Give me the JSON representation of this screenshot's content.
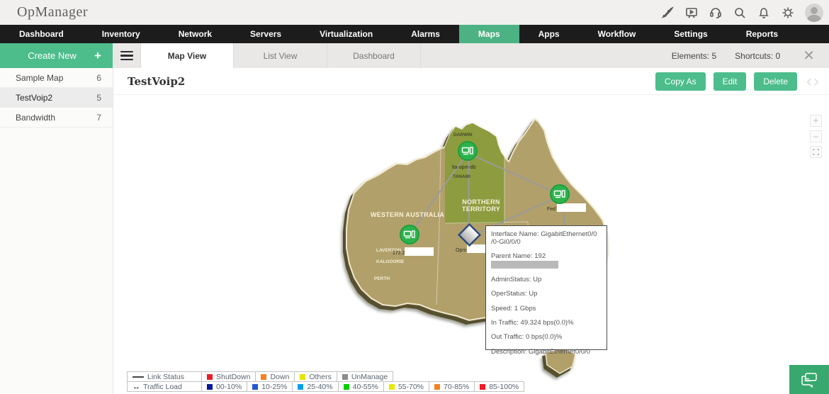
{
  "app": {
    "title": "OpManager"
  },
  "header_icons": [
    "rocket-icon",
    "presentation-icon",
    "headset-icon",
    "search-icon",
    "bell-icon",
    "gear-icon",
    "avatar"
  ],
  "nav": {
    "items": [
      {
        "label": "Dashboard",
        "active": false
      },
      {
        "label": "Inventory",
        "active": false
      },
      {
        "label": "Network",
        "active": false
      },
      {
        "label": "Servers",
        "active": false
      },
      {
        "label": "Virtualization",
        "active": false
      },
      {
        "label": "Alarms",
        "active": false
      },
      {
        "label": "Maps",
        "active": true
      },
      {
        "label": "Apps",
        "active": false
      },
      {
        "label": "Workflow",
        "active": false
      },
      {
        "label": "Settings",
        "active": false
      },
      {
        "label": "Reports",
        "active": false
      }
    ]
  },
  "sidebar": {
    "create_button": {
      "label": "Create New",
      "icon": "+"
    },
    "items": [
      {
        "label": "Sample Map",
        "count": "6",
        "selected": false
      },
      {
        "label": "TestVoip2",
        "count": "5",
        "selected": true
      },
      {
        "label": "Bandwidth",
        "count": "7",
        "selected": false
      }
    ]
  },
  "tabbar": {
    "tabs": [
      {
        "label": "Map View",
        "active": true
      },
      {
        "label": "List View",
        "active": false
      },
      {
        "label": "Dashboard",
        "active": false
      }
    ],
    "elements_label": "Elements:",
    "elements_value": "5",
    "shortcuts_label": "Shortcuts:",
    "shortcuts_value": "0"
  },
  "toolbar": {
    "title": "TestVoip2",
    "buttons": [
      "Copy As",
      "Edit",
      "Delete"
    ]
  },
  "map": {
    "controls": {
      "zoom_in": "+",
      "zoom_out": "–"
    },
    "labels": {
      "darwin": "DARWIN",
      "tanami": "TANAMI",
      "nt_line1": "NORTHERN",
      "nt_line2": "TERRITORY",
      "wa": "WESTERN AUSTRALIA",
      "laverton": "LAVERTON",
      "kalgoorlie": "KALGOORIE",
      "perth": "PERTH"
    },
    "nodes": {
      "darwin_device": {
        "label": "lta-opm-db"
      },
      "wa_device": {
        "label": "172.2"
      },
      "east_device": {
        "label": "Fed"
      },
      "selected_interface": {
        "label": "Opm"
      }
    },
    "colors": {
      "land": "#b2a06b",
      "territory": "#8d9c3f",
      "node_green": "#2db34d",
      "link_gray": "#9a9a9a"
    }
  },
  "tooltip": {
    "lines": [
      {
        "label": "Interface Name:",
        "value": "GigabitEthernet0/0 /0-Gi0/0/0"
      },
      {
        "label": "Parent Name:",
        "value": "192"
      },
      {
        "label": "AdminStatus:",
        "value": "Up"
      },
      {
        "label": "OperStatus:",
        "value": "Up"
      },
      {
        "label": "Speed:",
        "value": "1 Gbps"
      },
      {
        "label": "In Traffic:",
        "value": "49.324 bps(0.0)%"
      },
      {
        "label": "Out Traffic:",
        "value": "0 bps(0.0)%"
      },
      {
        "label": "Description:",
        "value": "GigabitEthernet0/0/0"
      }
    ]
  },
  "legend": {
    "rows": [
      {
        "title": "Link Status",
        "items": [
          {
            "label": "ShutDown",
            "color": "#ee1c25"
          },
          {
            "label": "Down",
            "color": "#f6821f"
          },
          {
            "label": "Others",
            "color": "#e8e400"
          },
          {
            "label": "UnManage",
            "color": "#8c8c8c"
          }
        ]
      },
      {
        "title": "Traffic Load",
        "items": [
          {
            "label": "00-10%",
            "color": "#001a99"
          },
          {
            "label": "10-25%",
            "color": "#2457d6"
          },
          {
            "label": "25-40%",
            "color": "#00a0f0"
          },
          {
            "label": "40-55%",
            "color": "#00d000"
          },
          {
            "label": "55-70%",
            "color": "#e8e800"
          },
          {
            "label": "70-85%",
            "color": "#f6821f"
          },
          {
            "label": "85-100%",
            "color": "#ee1c25"
          }
        ]
      }
    ]
  },
  "colors": {
    "accent": "#4cbd8b",
    "nav_active": "#4cb283",
    "chat": "#38a86e"
  }
}
